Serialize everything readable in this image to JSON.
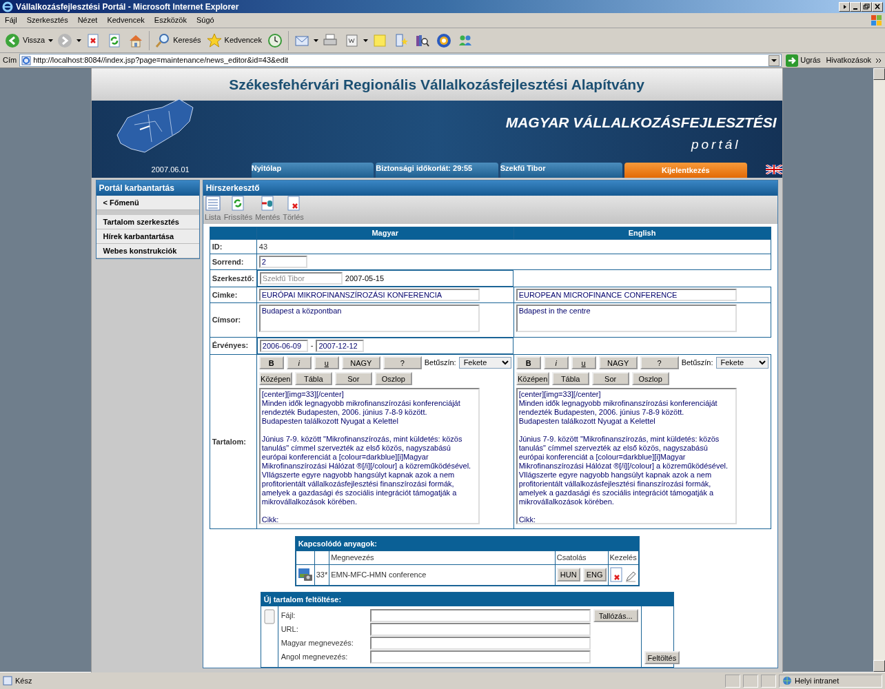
{
  "window": {
    "title": "Vállalkozásfejlesztési Portál - Microsoft Internet Explorer"
  },
  "menu": [
    "Fájl",
    "Szerkesztés",
    "Nézet",
    "Kedvencek",
    "Eszközök",
    "Súgó"
  ],
  "toolbar": [
    {
      "label": "Vissza",
      "dropdown": true
    },
    {
      "dropdown": true
    },
    {
      "dropdown": false
    },
    {
      "dropdown": false
    },
    {
      "dropdown": false
    },
    {
      "label": "Keresés",
      "dropdown": false
    },
    {
      "label": "Kedvencek",
      "dropdown": false
    },
    {
      "dropdown": false
    },
    {
      "dropdown": true
    },
    {
      "dropdown": false
    },
    {
      "dropdown": true
    },
    {
      "dropdown": false
    },
    {
      "dropdown": false
    },
    {
      "dropdown": false
    },
    {
      "dropdown": false
    },
    {
      "dropdown": false
    }
  ],
  "address": {
    "label": "Cím",
    "url": "http://localhost:8084//index.jsp?page=maintenance/news_editor&id=43&edit",
    "go": "Ugrás",
    "links": "Hivatkozások"
  },
  "header": {
    "title": "Székesfehérvári Regionális Vállalkozásfejlesztési Alapítvány",
    "banner": "MAGYAR VÁLLALKOZÁSFEJLESZTÉSI",
    "subtitle": "portál",
    "date": "2007.06.01"
  },
  "nav": [
    {
      "label": "Nyitólap",
      "kind": "nav"
    },
    {
      "label": "Biztonsági időkorlát: 29:55",
      "kind": "nav"
    },
    {
      "label": "Szekfű Tibor",
      "kind": "nav"
    },
    {
      "label": "Kijelentkezés",
      "kind": "logout"
    }
  ],
  "sidebar": {
    "title": "Portál karbantartás",
    "items": [
      {
        "label": "< Főmenü",
        "kind": "back"
      },
      {
        "label": "Tartalom szerkesztés",
        "kind": "link"
      },
      {
        "label": "Hírek karbantartása",
        "kind": "link"
      },
      {
        "label": "Webes konstrukciók",
        "kind": "link"
      }
    ]
  },
  "editor": {
    "title": "Hírszerkesztő",
    "tools": [
      {
        "label": "Lista"
      },
      {
        "label": "Frissítés"
      },
      {
        "label": "Mentés"
      },
      {
        "label": "Törlés"
      }
    ],
    "columns": [
      "Magyar",
      "English"
    ],
    "id": {
      "label": "ID:",
      "value": "43"
    },
    "order": {
      "label": "Sorrend:",
      "value": "2"
    },
    "author": {
      "label": "Szerkesztő:",
      "value": "Szekfű Tibor",
      "disabled": true,
      "date": "2007-05-15"
    },
    "tag": {
      "label": "Cimke:",
      "values": [
        "EURÓPAI MIKROFINANSZÍROZÁSI KONFERENCIA",
        "EUROPEAN MICROFINANCE CONFERENCE"
      ]
    },
    "headline": {
      "label": "Címsor:",
      "values": [
        "Budapest a központban",
        "Bdapest in the centre"
      ]
    },
    "valid": {
      "label": "Érvényes:",
      "from": "2006-06-09",
      "separator": "-",
      "to": "2007-12-12"
    },
    "content": {
      "label": "Tartalom:",
      "editors": [
        {
          "format_buttons": [
            {
              "label": "B",
              "kind": "bold"
            },
            {
              "label": "i",
              "kind": "italic"
            },
            {
              "label": "u",
              "kind": "underline"
            },
            {
              "label": "NAGY",
              "kind": "plain"
            },
            {
              "label": "?",
              "kind": "plain"
            }
          ],
          "layout_buttons": [
            "Középen",
            "Tábla",
            "Sor",
            "Oszlop"
          ],
          "color_label": "Betűszín:",
          "font_color": "Fekete",
          "text": "[center][img=33][/center]\nMinden idők legnagyobb mikrofinanszírozási konferenciáját rendezték Budapesten, 2006. június 7-8-9 között.\nBudapesten találkozott Nyugat a Kelettel\n\nJúnius 7-9. között \"Mikrofinanszírozás, mint küldetés: közös tanulás\" címmel szervezték az első közös, nagyszabású európai konferenciát a [colour=darkblue][i]Magyar Mikrofinanszírozási Hálózat ®[/i][/colour] a közreműködésével. VIlágszerte egyre nagyobb hangsúlyt kapnak azok a nem profitorientált vállalkozásfejlesztési finanszírozási formák, amelyek a gazdasági és szociális integrációt támogatják a mikrovállalkozások körében.\n\nCikk:"
        },
        {
          "format_buttons": [
            {
              "label": "B",
              "kind": "bold"
            },
            {
              "label": "i",
              "kind": "italic"
            },
            {
              "label": "u",
              "kind": "underline"
            },
            {
              "label": "NAGY",
              "kind": "plain"
            },
            {
              "label": "?",
              "kind": "plain"
            }
          ],
          "layout_buttons": [
            "Középen",
            "Tábla",
            "Sor",
            "Oszlop"
          ],
          "color_label": "Betűszín:",
          "font_color": "Fekete",
          "text": "[center][img=33][/center]\nMinden idők legnagyobb mikrofinanszírozási konferenciáját rendezték Budapesten, 2006. június 7-8-9 között.\nBudapesten találkozott Nyugat a Kelettel\n\nJúnius 7-9. között \"Mikrofinanszírozás, mint küldetés: közös tanulás\" címmel szervezték az első közös, nagyszabású európai konferenciát a [colour=darkblue][i]Magyar Mikrofinanszírozási Hálózat ®[/i][/colour] a közreműködésével. VIlágszerte egyre nagyobb hangsúlyt kapnak azok a nem profitorientált vállalkozásfejlesztési finanszírozási formák, amelyek a gazdasági és szociális integrációt támogatják a mikrovállalkozások körében.\n\nCikk:"
        }
      ]
    }
  },
  "related": {
    "title": "Kapcsolódó anyagok:",
    "columns": {
      "name": "Megnevezés",
      "attach": "Csatolás",
      "manage": "Kezelés"
    },
    "rows": [
      {
        "number": "33*",
        "name": "EMN-MFC-HMN conference",
        "attachments": [
          "HUN",
          "ENG"
        ]
      }
    ]
  },
  "upload": {
    "title": "Új tartalom feltöltése:",
    "fields": [
      {
        "label": "Fájl:",
        "browse": "Tallózás..."
      },
      {
        "label": "URL:"
      },
      {
        "label": "Magyar megnevezés:"
      },
      {
        "label": "Angol megnevezés:"
      }
    ],
    "submit": "Feltöltés"
  },
  "status_bar": {
    "text": "Kész",
    "zone": "Helyi intranet"
  }
}
